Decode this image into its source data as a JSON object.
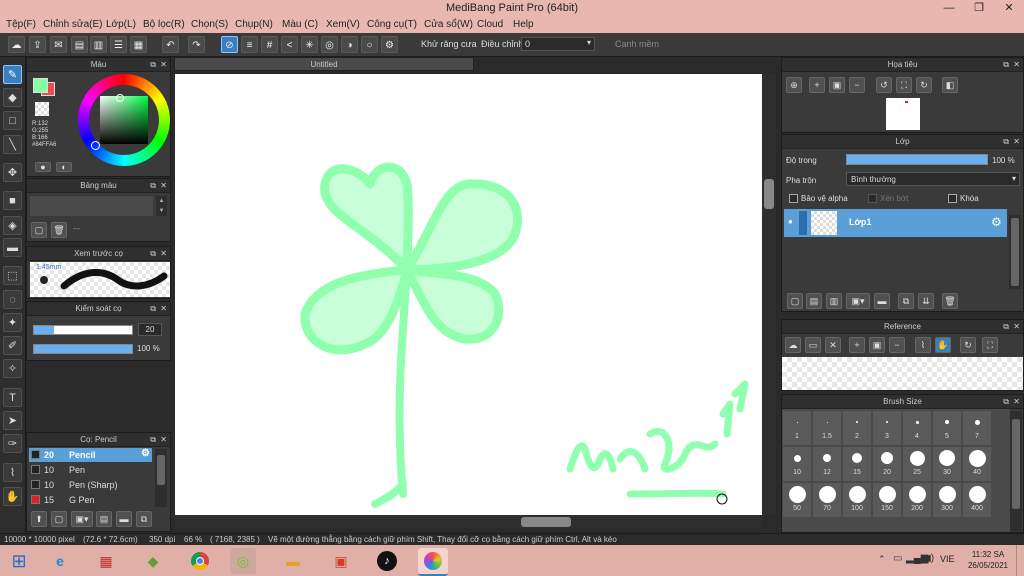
{
  "window": {
    "title": "MediBang Paint Pro (64bit)"
  },
  "menu": [
    "Tệp(F)",
    "Chỉnh sửa(E)",
    "Lớp(L)",
    "Bộ lọc(R)",
    "Chọn(S)",
    "Chụp(N)",
    "Màu (C)",
    "Xem(V)",
    "Công cụ(T)",
    "Cửa sổ(W)",
    "Cloud",
    "Help"
  ],
  "toolbar": {
    "antialias_label": "Khử răng cưa",
    "correction_label": "Điều chỉnh",
    "correction_value": "0",
    "smooth_label": "Canh mềm"
  },
  "color_panel": {
    "title": "Màu",
    "r": "R:132",
    "g": "G:255",
    "b": "B:166",
    "hex": "#84FFA6",
    "primary_color": "#84FFA6",
    "secondary_color": "#e85050"
  },
  "palette_panel": {
    "title": "Bảng màu",
    "footer": "---"
  },
  "brush_preview_panel": {
    "title": "Xem trước cọ",
    "size": "1.45mm"
  },
  "brush_control_panel": {
    "title": "Kiểm soát cọ",
    "size_value": "20",
    "opacity_value": "100 %",
    "size_fill": 0.2,
    "opacity_fill": 1.0
  },
  "brush_list_panel": {
    "title": "Cọ: Pencil",
    "items": [
      {
        "size": "20",
        "name": "Pencil",
        "selected": true,
        "color": "#222222"
      },
      {
        "size": "10",
        "name": "Pen",
        "selected": false,
        "color": "#222222"
      },
      {
        "size": "10",
        "name": "Pen (Sharp)",
        "selected": false,
        "color": "#222222"
      },
      {
        "size": "15",
        "name": "G Pen",
        "selected": false,
        "color": "#e02020"
      }
    ]
  },
  "document": {
    "tab_title": "Untitled"
  },
  "navigator_panel": {
    "title": "Họa tiêu"
  },
  "layer_panel": {
    "title": "Lớp",
    "opacity_label": "Độ trong",
    "opacity_value": "100 %",
    "blend_label": "Pha trộn",
    "blend_value": "Bình thường",
    "protect_alpha_label": "Bảo vệ alpha",
    "clipping_label": "Xén bớt",
    "lock_label": "Khóa",
    "layers": [
      {
        "name": "Lớp1"
      }
    ]
  },
  "reference_panel": {
    "title": "Reference"
  },
  "brush_size_panel": {
    "title": "Brush Size",
    "sizes": [
      "1",
      "1.5",
      "2",
      "3",
      "4",
      "5",
      "7",
      "10",
      "12",
      "15",
      "20",
      "25",
      "30",
      "40",
      "50",
      "70",
      "100",
      "150",
      "200",
      "300",
      "400"
    ]
  },
  "status": {
    "canvas_size": "10000 * 10000 pixel",
    "physical_size": "(72.6 * 72.6cm)",
    "dpi": "350 dpi",
    "zoom": "66 %",
    "cursor": "( 7168, 2385 )",
    "hint": "Vẽ một đường thẳng bằng cách giữ phím Shift, Thay đổi cỡ cọ bằng cách giữ phím Ctrl, Alt và kéo"
  },
  "taskbar": {
    "lang": "VIE",
    "time": "11:32 SA",
    "date": "26/05/2021"
  },
  "colors": {
    "stroke": "#84FFA6",
    "accent": "#5aa0e0"
  }
}
